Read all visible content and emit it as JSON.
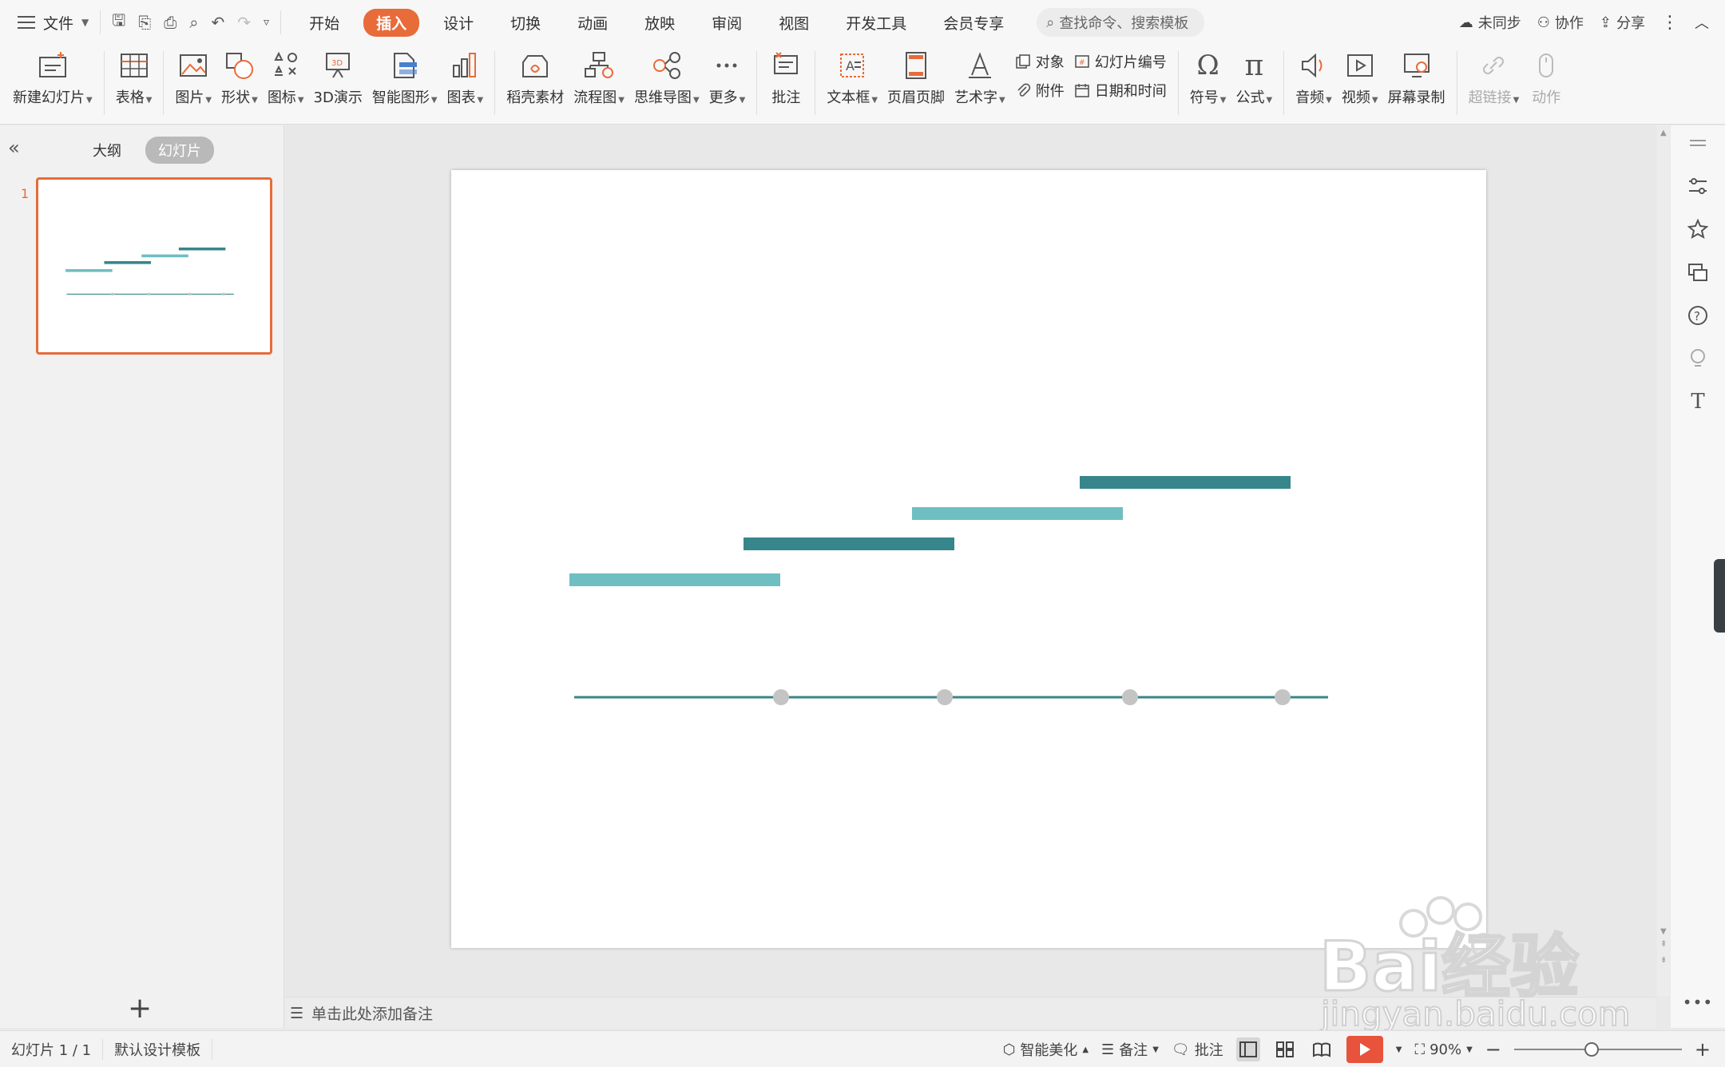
{
  "menubar": {
    "file_label": "文件",
    "tabs": [
      {
        "label": "开始",
        "active": false
      },
      {
        "label": "插入",
        "active": true
      },
      {
        "label": "设计",
        "active": false
      },
      {
        "label": "切换",
        "active": false
      },
      {
        "label": "动画",
        "active": false
      },
      {
        "label": "放映",
        "active": false
      },
      {
        "label": "审阅",
        "active": false
      },
      {
        "label": "视图",
        "active": false
      },
      {
        "label": "开发工具",
        "active": false
      },
      {
        "label": "会员专享",
        "active": false
      }
    ],
    "search_placeholder": "查找命令、搜索模板",
    "sync_label": "未同步",
    "collab_label": "协作",
    "share_label": "分享"
  },
  "ribbon": {
    "new_slide": "新建幻灯片",
    "table": "表格",
    "picture": "图片",
    "shape": "形状",
    "icon": "图标",
    "demo3d": "3D演示",
    "smartart": "智能图形",
    "chart": "图表",
    "docer": "稻壳素材",
    "flowchart": "流程图",
    "mindmap": "思维导图",
    "more": "更多",
    "comment": "批注",
    "textbox": "文本框",
    "header_footer": "页眉页脚",
    "wordart": "艺术字",
    "object": "对象",
    "slide_number": "幻灯片编号",
    "attachment": "附件",
    "datetime": "日期和时间",
    "symbol": "符号",
    "formula": "公式",
    "audio": "音频",
    "video": "视频",
    "screen_record": "屏幕录制",
    "hyperlink": "超链接",
    "action": "动作"
  },
  "leftpanel": {
    "outline_tab": "大纲",
    "slides_tab": "幻灯片",
    "slide_number": "1"
  },
  "notes": {
    "placeholder": "单击此处添加备注"
  },
  "statusbar": {
    "slide_info": "幻灯片 1 / 1",
    "template": "默认设计模板",
    "beautify": "智能美化",
    "notes": "备注",
    "comments": "批注",
    "zoom": "90%"
  },
  "colors": {
    "accent": "#e86b3a",
    "bar_dark": "#37868b",
    "bar_light": "#6fbec2",
    "timeline": "#37868b",
    "dot": "#c4c4c4"
  },
  "watermark": {
    "brand": "Bai经验",
    "url": "jingyan.baidu.com"
  }
}
